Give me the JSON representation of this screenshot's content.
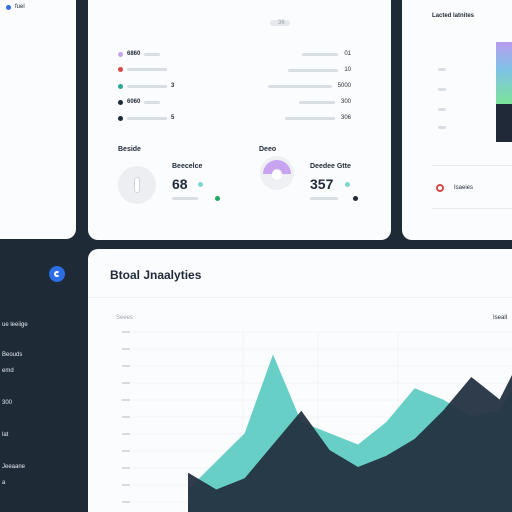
{
  "top_left": {
    "nav_label": "fuel"
  },
  "stats": {
    "header_value": "36",
    "left_rows": [
      {
        "value": "6860",
        "suffix": "",
        "color": "#c7a3f0"
      },
      {
        "value": "",
        "suffix": "",
        "color": "#d94848"
      },
      {
        "value": "",
        "suffix": "3",
        "color": "#2aa79b"
      },
      {
        "value": "6060",
        "suffix": "",
        "color": "#1f2937"
      },
      {
        "value": "",
        "suffix": "5",
        "color": "#1f2937"
      }
    ],
    "right_rows": [
      {
        "value": "01"
      },
      {
        "value": "10"
      },
      {
        "value": "5000"
      },
      {
        "value": "300"
      },
      {
        "value": "306"
      }
    ],
    "left_widget": {
      "title": "Beside",
      "subtitle": "Beecelce",
      "value": "68"
    },
    "right_widget": {
      "title": "Deeo",
      "subtitle": "Deedee Gtte",
      "value": "357",
      "ring_progress": 0.55
    }
  },
  "top_right": {
    "title": "Lacted latnites",
    "legend_label": "Isaeies",
    "accent": "#d94848"
  },
  "analytics": {
    "title": "Btoal Jnaalyties",
    "left_label": "Seees",
    "right_label": "Iseall"
  },
  "sidebar": {
    "items": [
      {
        "label": "ue leeiige"
      },
      {
        "label": "Beouds"
      },
      {
        "label": "emd"
      },
      {
        "label": "300"
      },
      {
        "label": "lat"
      },
      {
        "label": "Jeeaane"
      },
      {
        "label": "a"
      }
    ]
  },
  "chart_data": {
    "type": "area",
    "x": [
      0,
      1,
      2,
      3,
      4,
      5,
      6,
      7,
      8,
      9,
      10,
      11,
      12
    ],
    "series": [
      {
        "values": [
          20,
          45,
          70,
          140,
          80,
          70,
          60,
          80,
          110,
          100,
          85,
          90,
          130
        ]
      },
      {
        "values": [
          35,
          20,
          30,
          60,
          90,
          55,
          40,
          50,
          65,
          90,
          120,
          100,
          150
        ]
      }
    ],
    "ylim": [
      0,
      160
    ]
  }
}
